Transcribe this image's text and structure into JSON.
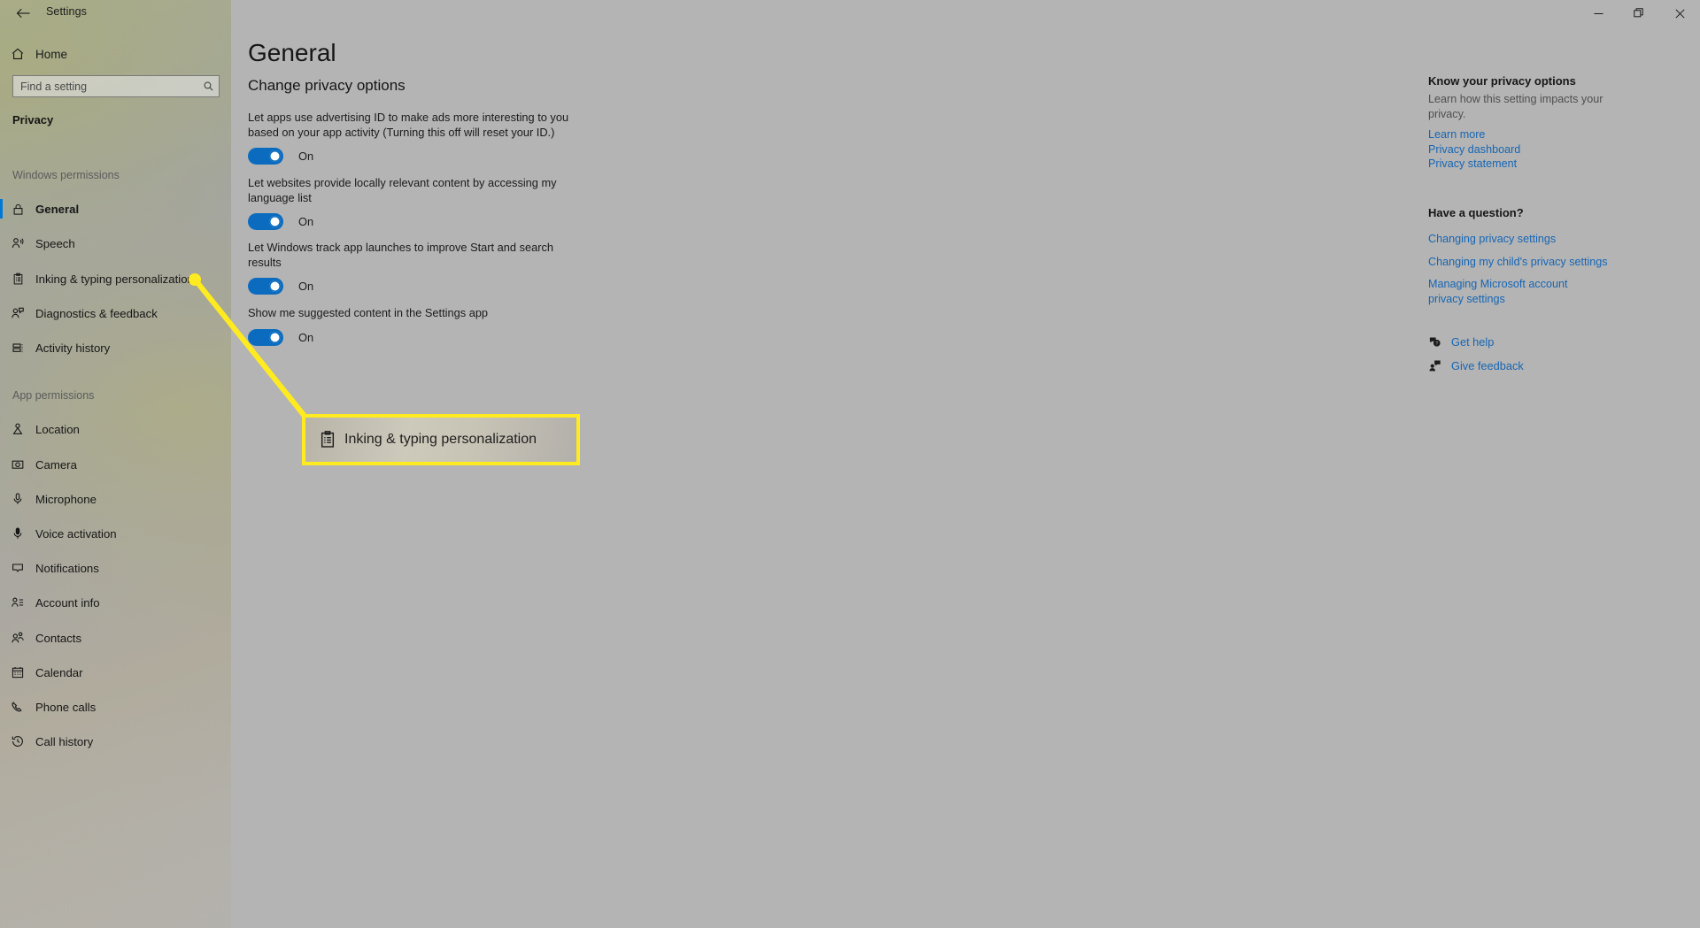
{
  "window": {
    "title": "Settings",
    "back_icon": "back-arrow-icon",
    "minimize_label": "Minimize",
    "maximize_label": "Restore",
    "close_label": "Close"
  },
  "sidebar": {
    "home": {
      "label": "Home",
      "icon": "home-icon"
    },
    "search": {
      "placeholder": "Find a setting",
      "icon": "search-icon",
      "value": ""
    },
    "category": "Privacy",
    "groups": [
      {
        "header": "Windows permissions",
        "items": [
          {
            "label": "General",
            "icon": "lock-icon",
            "selected": true
          },
          {
            "label": "Speech",
            "icon": "speech-person-icon",
            "selected": false
          },
          {
            "label": "Inking & typing personalization",
            "icon": "clipboard-icon",
            "selected": false
          },
          {
            "label": "Diagnostics & feedback",
            "icon": "feedback-person-icon",
            "selected": false
          },
          {
            "label": "Activity history",
            "icon": "activity-history-icon",
            "selected": false
          }
        ]
      },
      {
        "header": "App permissions",
        "items": [
          {
            "label": "Location",
            "icon": "location-pin-icon",
            "selected": false
          },
          {
            "label": "Camera",
            "icon": "camera-icon",
            "selected": false
          },
          {
            "label": "Microphone",
            "icon": "microphone-icon",
            "selected": false
          },
          {
            "label": "Voice activation",
            "icon": "voice-activation-icon",
            "selected": false
          },
          {
            "label": "Notifications",
            "icon": "notification-icon",
            "selected": false
          },
          {
            "label": "Account info",
            "icon": "account-info-icon",
            "selected": false
          },
          {
            "label": "Contacts",
            "icon": "contacts-icon",
            "selected": false
          },
          {
            "label": "Calendar",
            "icon": "calendar-icon",
            "selected": false
          },
          {
            "label": "Phone calls",
            "icon": "phone-icon",
            "selected": false
          },
          {
            "label": "Call history",
            "icon": "call-history-icon",
            "selected": false
          }
        ]
      }
    ]
  },
  "main": {
    "page_title": "General",
    "section_title": "Change privacy options",
    "options": [
      {
        "label": "Let apps use advertising ID to make ads more interesting to you based on your app activity (Turning this off will reset your ID.)",
        "state": "On",
        "enabled": true
      },
      {
        "label": "Let websites provide locally relevant content by accessing my language list",
        "state": "On",
        "enabled": true
      },
      {
        "label": "Let Windows track app launches to improve Start and search results",
        "state": "On",
        "enabled": true
      },
      {
        "label": "Show me suggested content in the Settings app",
        "state": "On",
        "enabled": true
      }
    ]
  },
  "rail": {
    "privacy": {
      "heading": "Know your privacy options",
      "body": "Learn how this setting impacts your privacy.",
      "links": [
        "Learn more",
        "Privacy dashboard",
        "Privacy statement"
      ]
    },
    "question": {
      "heading": "Have a question?",
      "links": [
        "Changing privacy settings",
        "Changing my child's privacy settings",
        "Managing Microsoft account privacy settings"
      ]
    },
    "actions": [
      {
        "label": "Get help",
        "icon": "help-chat-icon"
      },
      {
        "label": "Give feedback",
        "icon": "feedback-icon"
      }
    ]
  },
  "callout": {
    "label": "Inking & typing personalization",
    "icon": "clipboard-icon",
    "highlight_color": "#ffeb1f"
  },
  "colors": {
    "accent": "#0078d4",
    "toggle_on": "#0b6cbf",
    "link": "#1666b5",
    "highlight": "#ffeb1f",
    "content_bg": "#b4b4b4"
  }
}
